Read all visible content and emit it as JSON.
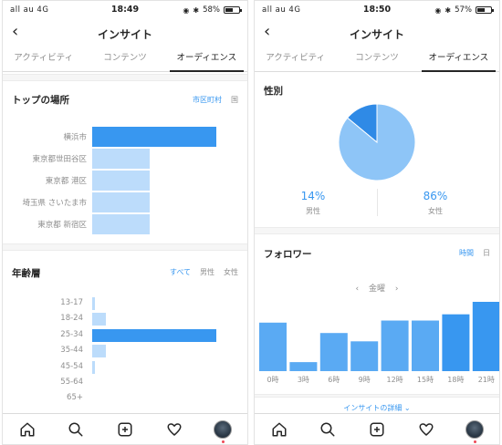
{
  "left": {
    "status": {
      "carrier": "all au  4G",
      "time": "18:49",
      "battery": "58%",
      "battery_level": 0.58
    },
    "nav": {
      "title": "インサイト",
      "back": "‹"
    },
    "tabs": [
      {
        "label": "アクティビティ",
        "active": false
      },
      {
        "label": "コンテンツ",
        "active": false
      },
      {
        "label": "オーディエンス",
        "active": true
      }
    ],
    "locations": {
      "title": "トップの場所",
      "filters": [
        {
          "label": "市区町村",
          "active": true
        },
        {
          "label": "国",
          "active": false
        }
      ],
      "items": [
        {
          "label": "横浜市",
          "value": 1.0,
          "highlight": true
        },
        {
          "label": "東京都世田谷区",
          "value": 0.46,
          "highlight": false
        },
        {
          "label": "東京都 港区",
          "value": 0.46,
          "highlight": false
        },
        {
          "label": "埼玉県 さいたま市",
          "value": 0.46,
          "highlight": false
        },
        {
          "label": "東京都 新宿区",
          "value": 0.46,
          "highlight": false
        }
      ]
    },
    "age": {
      "title": "年齢層",
      "filters": [
        {
          "label": "すべて",
          "active": true
        },
        {
          "label": "男性",
          "active": false
        },
        {
          "label": "女性",
          "active": false
        }
      ],
      "items": [
        {
          "label": "13-17",
          "value": 0.02,
          "highlight": false
        },
        {
          "label": "18-24",
          "value": 0.11,
          "highlight": false
        },
        {
          "label": "25-34",
          "value": 1.0,
          "highlight": true
        },
        {
          "label": "35-44",
          "value": 0.11,
          "highlight": false
        },
        {
          "label": "45-54",
          "value": 0.02,
          "highlight": false
        },
        {
          "label": "55-64",
          "value": 0.0,
          "highlight": false
        },
        {
          "label": "65+",
          "value": 0.0,
          "highlight": false
        }
      ]
    }
  },
  "right": {
    "status": {
      "carrier": "all au  4G",
      "time": "18:50",
      "battery": "57%",
      "battery_level": 0.57
    },
    "nav": {
      "title": "インサイト",
      "back": "‹"
    },
    "tabs": [
      {
        "label": "アクティビティ",
        "active": false
      },
      {
        "label": "コンテンツ",
        "active": false
      },
      {
        "label": "オーディエンス",
        "active": true
      }
    ],
    "gender": {
      "title": "性別",
      "male_pct": "14%",
      "male_label": "男性",
      "female_pct": "86%",
      "female_label": "女性"
    },
    "followers": {
      "title": "フォロワー",
      "filters": [
        {
          "label": "時間",
          "active": true
        },
        {
          "label": "日",
          "active": false
        }
      ],
      "day": "金曜",
      "prev": "‹",
      "next": "›",
      "detail_link": "インサイトの詳細"
    }
  },
  "colors": {
    "accent": "#3897f0",
    "light_bar": "#bcdcfb",
    "pie_light": "#8ec5f7",
    "pie_dark": "#2f8ae6"
  },
  "chart_data": [
    {
      "type": "pie",
      "title": "性別",
      "categories": [
        "男性",
        "女性"
      ],
      "values": [
        14,
        86
      ]
    },
    {
      "type": "bar",
      "title": "フォロワー",
      "categories": [
        "0時",
        "3時",
        "6時",
        "9時",
        "12時",
        "15時",
        "18時",
        "21時"
      ],
      "values": [
        0.7,
        0.13,
        0.55,
        0.43,
        0.73,
        0.73,
        0.82,
        1.0
      ],
      "highlight": [
        false,
        false,
        false,
        false,
        false,
        false,
        true,
        true
      ],
      "ylim": [
        0,
        1
      ]
    }
  ]
}
